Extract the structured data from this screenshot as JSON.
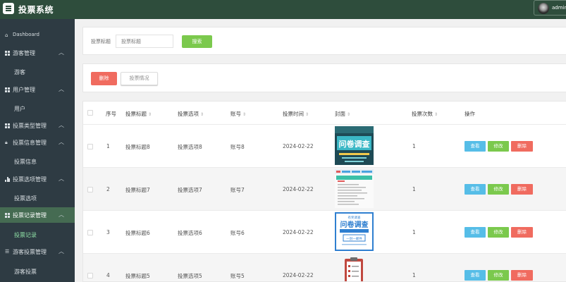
{
  "header": {
    "title": "投票系统",
    "username": "admin"
  },
  "sidebar": {
    "dashboard": "Dashboard",
    "groups": [
      {
        "label": "游客管理",
        "sub": "游客"
      },
      {
        "label": "用户管理",
        "sub": "用户"
      },
      {
        "label": "投票类型管理"
      },
      {
        "label": "投票信息管理",
        "sub": "投票信息"
      },
      {
        "label": "投票选项管理",
        "sub": "投票选项"
      },
      {
        "label": "投票记录管理",
        "sub": "投票记录"
      },
      {
        "label": "游客投票管理",
        "sub": "游客投票"
      }
    ]
  },
  "search": {
    "label": "投票标题",
    "placeholder": "投票标题",
    "button": "搜索"
  },
  "actions": {
    "delete": "删除",
    "vote_status": "投票情况"
  },
  "table": {
    "headers": {
      "index": "序号",
      "title": "投票标题",
      "option": "投票选项",
      "account": "账号",
      "time": "投票时间",
      "cover": "封面",
      "count": "投票次数",
      "ops": "操作"
    },
    "rows": [
      {
        "index": "1",
        "title": "投票标题8",
        "option": "投票选项8",
        "account": "账号8",
        "time": "2024-02-22",
        "count": "1"
      },
      {
        "index": "2",
        "title": "投票标题7",
        "option": "投票选项7",
        "account": "账号7",
        "time": "2024-02-22",
        "count": "1"
      },
      {
        "index": "3",
        "title": "投票标题6",
        "option": "投票选项6",
        "account": "账号6",
        "time": "2024-02-22",
        "count": "1"
      },
      {
        "index": "4",
        "title": "投票标题5",
        "option": "投票选项5",
        "account": "账号5",
        "time": "2024-02-22",
        "count": "1"
      }
    ],
    "buttons": {
      "view": "查看",
      "edit": "修改",
      "delete": "删除"
    },
    "cover_texts": {
      "row1": "问卷调查",
      "row3_top": "有奖调查",
      "row3_main": "问卷调查",
      "row3_sub": "一封一邮件"
    }
  },
  "colors": {
    "header": "#2e4d3c",
    "sidebar": "#2e3b43",
    "active": "#456b52",
    "green": "#7bc94d",
    "red": "#f06b5f",
    "blue": "#56bde7"
  }
}
